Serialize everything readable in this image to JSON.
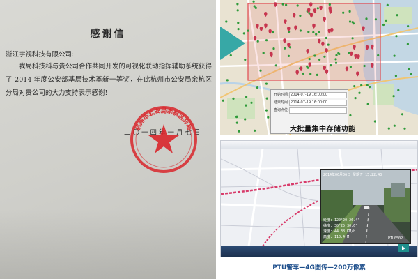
{
  "letter": {
    "title": "感谢信",
    "addressee": "浙江宇视科技有限公司:",
    "body": "我局科技科与贵公司合作共同开发的可视化联动指挥辅助系统获得了 2014 年度公安部基层技术革新一等奖，在此杭州市公安局余杭区分局对贵公司的大力支持表示感谢!",
    "date": "二〇一四年一月七日",
    "seal_text": "杭州市公安局余杭区分局",
    "seal_color": "#d8262b"
  },
  "map_panel": {
    "caption": "大批量集中存储功能",
    "start_time": "2014-07-19 16:00:00",
    "end_time": "2014-07-19 16:00:00",
    "arrow_color": "#37a8a6",
    "highlight_color": "#e0494f"
  },
  "ptu_panel": {
    "caption": "PTU警车—4G图传—200万像素",
    "video_timestamp": "2014年06月06日 星期五 15:22:43",
    "video_lines": [
      "经度: 120°20'26.4\"",
      "纬度: 30°25'30.6\"",
      "速度: 44.38 KM/h",
      "高度: 110.4 M"
    ],
    "camera_tag": "PTU050P",
    "route_color": "#d83b6a",
    "caption_color": "#1e4f8c"
  }
}
